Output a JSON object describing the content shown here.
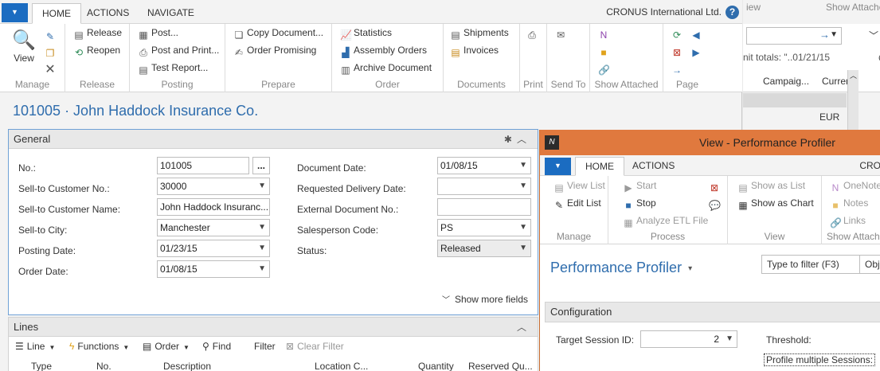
{
  "main": {
    "tabs": [
      "HOME",
      "ACTIONS",
      "NAVIGATE"
    ],
    "company": "CRONUS International Ltd.",
    "help": "?",
    "ribbon": {
      "manage": {
        "label": "Manage",
        "view": "View"
      },
      "release": {
        "label": "Release",
        "release": "Release",
        "reopen": "Reopen"
      },
      "posting": {
        "label": "Posting",
        "post": "Post...",
        "post_print": "Post and Print...",
        "test_report": "Test Report..."
      },
      "prepare": {
        "label": "Prepare",
        "copy_document": "Copy Document...",
        "order_promising": "Order Promising"
      },
      "order": {
        "label": "Order",
        "statistics": "Statistics",
        "assembly_orders": "Assembly Orders",
        "archive_document": "Archive Document"
      },
      "documents": {
        "label": "Documents",
        "shipments": "Shipments",
        "invoices": "Invoices"
      },
      "print": {
        "label": "Print"
      },
      "send_to": {
        "label": "Send To"
      },
      "show_attached": {
        "label": "Show Attached"
      },
      "page": {
        "label": "Page"
      }
    },
    "title": "101005 · John Haddock Insurance Co.",
    "general": {
      "header": "General",
      "fields_left": [
        {
          "label": "No.:",
          "value": "101005"
        },
        {
          "label": "Sell-to Customer No.:",
          "value": "30000"
        },
        {
          "label": "Sell-to Customer Name:",
          "value": "John Haddock Insuranc..."
        },
        {
          "label": "Sell-to City:",
          "value": "Manchester"
        },
        {
          "label": "Posting Date:",
          "value": "01/23/15"
        },
        {
          "label": "Order Date:",
          "value": "01/08/15"
        }
      ],
      "fields_right": [
        {
          "label": "Document Date:",
          "value": "01/08/15"
        },
        {
          "label": "Requested Delivery Date:",
          "value": ""
        },
        {
          "label": "External Document No.:",
          "value": ""
        },
        {
          "label": "Salesperson Code:",
          "value": "PS"
        },
        {
          "label": "Status:",
          "value": "Released"
        }
      ],
      "assist_button": "...",
      "show_more": "Show more fields"
    },
    "lines": {
      "header": "Lines",
      "toolbar": [
        "Line",
        "Functions",
        "Order",
        "Find",
        "Filter",
        "Clear Filter"
      ],
      "columns": [
        "Type",
        "No.",
        "Description",
        "Location C...",
        "Quantity",
        "Reserved Qu..."
      ]
    }
  },
  "background_window": {
    "show_attached": "Show Attached",
    "iew": "iew",
    "unit_totals": "nit totals: \"..01/21/15",
    "campaign": "Campaig...",
    "currency": "Curren",
    "eur": "EUR",
    "chars": [
      "C",
      "E",
      "Y"
    ]
  },
  "profiler": {
    "window_title": "View - Performance Profiler",
    "tabs": [
      "HOME",
      "ACTIONS"
    ],
    "cro": "CRO",
    "ribbon": {
      "manage": {
        "label": "Manage",
        "view_list": "View List",
        "edit_list": "Edit List"
      },
      "process": {
        "label": "Process",
        "start": "Start",
        "stop": "Stop",
        "analyze": "Analyze ETL File"
      },
      "view": {
        "label": "View",
        "show_list": "Show as List",
        "show_chart": "Show as Chart"
      },
      "show_attached": {
        "label": "Show Attache",
        "onenote": "OneNote",
        "notes": "Notes",
        "links": "Links"
      }
    },
    "page_title": "Performance Profiler",
    "filter_placeholder": "Type to filter (F3)",
    "filter_field": "Obj",
    "configuration": "Configuration",
    "target_session_label": "Target Session ID:",
    "target_session_value": "2",
    "threshold_label": "Threshold:",
    "profile_multiple": "Profile multiple Sessions:"
  },
  "colors": {
    "accent_blue": "#2f6dad",
    "app_button": "#1b6cc1",
    "profiler_titlebar": "#e0793e"
  }
}
